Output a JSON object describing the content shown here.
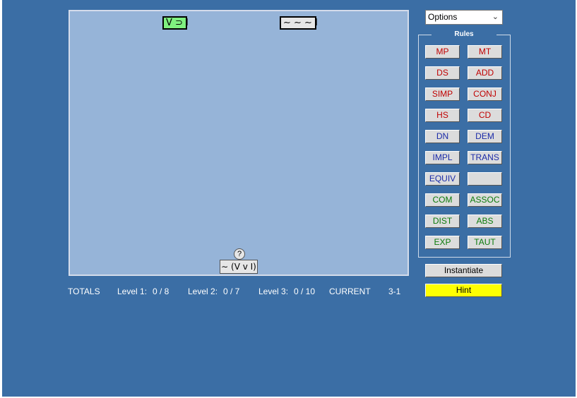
{
  "options": {
    "label": "Options",
    "chevron": "chevron-down-icon"
  },
  "board": {
    "premises": [
      "V ⊃ I",
      "∼ ∼ ∼ I"
    ],
    "goal_marker": "?",
    "goal": "∼ (V v I)"
  },
  "totals": {
    "label": "TOTALS",
    "level1_label": "Level 1:",
    "level1_value": "0 / 8",
    "level2_label": "Level 2:",
    "level2_value": "0 / 7",
    "level3_label": "Level 3:",
    "level3_value": "0 / 10",
    "current_label": "CURRENT",
    "current_value": "3-1"
  },
  "rules": {
    "title": "Rules",
    "buttons": [
      "MP",
      "MT",
      "DS",
      "ADD",
      "SIMP",
      "CONJ",
      "HS",
      "CD",
      "DN",
      "DEM",
      "IMPL",
      "TRANS",
      "EQUIV",
      "",
      "COM",
      "ASSOC",
      "DIST",
      "ABS",
      "EXP",
      "TAUT"
    ]
  },
  "actions": {
    "instantiate": "Instantiate",
    "hint": "Hint"
  },
  "colors": {
    "background": "#3b6ea5",
    "board": "#96b4d8",
    "inference_rule": "#c00000",
    "equivalence_rule": "#1a2aa8",
    "logic_rule": "#0a7a0a",
    "hint": "#ffff00",
    "selected_premise": "#7ff07f"
  }
}
